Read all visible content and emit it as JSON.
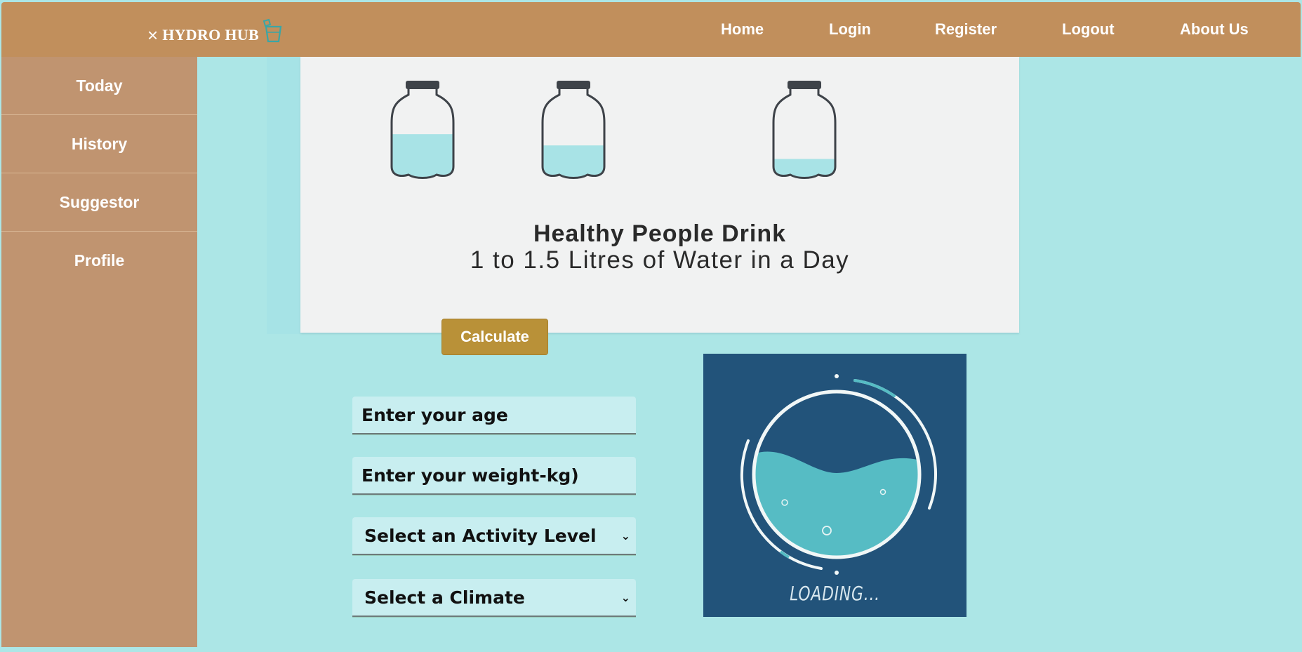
{
  "header": {
    "close_glyph": "×",
    "brand": "HYDRO HUB",
    "nav": [
      "Home",
      "Login",
      "Register",
      "Logout",
      "About Us"
    ]
  },
  "sidebar": {
    "items": [
      "Today",
      "History",
      "Suggestor",
      "Profile"
    ]
  },
  "poster": {
    "headline": "Healthy People Drink",
    "subheadline": "1 to 1.5 Litres of Water in a Day",
    "bottle_fill_levels": [
      0.55,
      0.4,
      0.22
    ]
  },
  "form": {
    "calculate_label": "Calculate",
    "age_placeholder": "Enter your age",
    "weight_placeholder": "Enter your weight-kg)",
    "activity_selected": "Select an Activity Level",
    "climate_selected": "Select a Climate"
  },
  "loader": {
    "text": "LOADING..."
  },
  "colors": {
    "background": "#ace6e6",
    "header": "#c18f5c",
    "sidebar": "#c09470",
    "button": "#b99138",
    "loader_bg": "#22537a",
    "water": "#56bcc4"
  }
}
